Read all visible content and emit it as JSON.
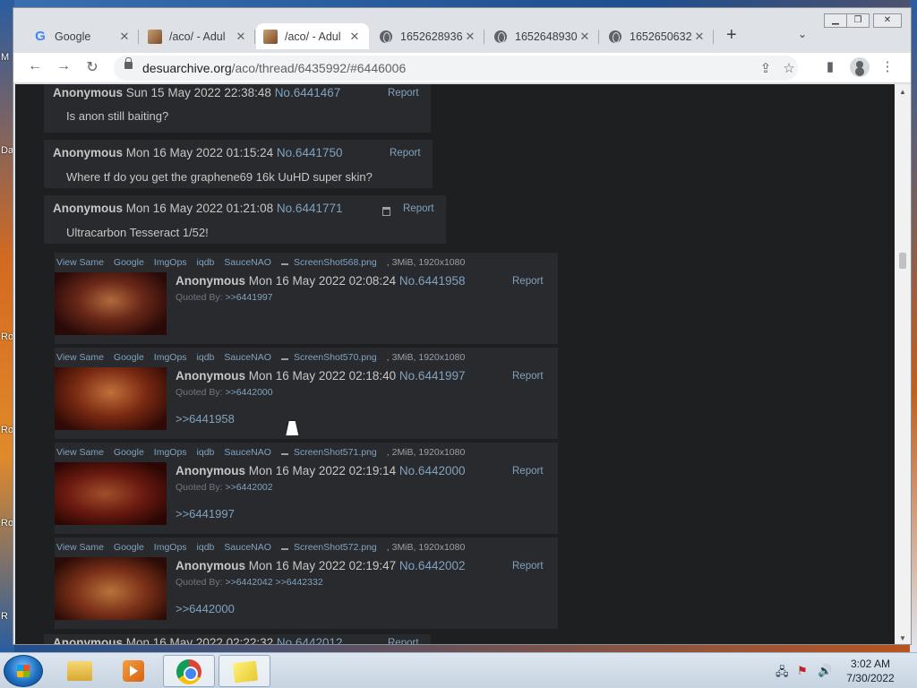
{
  "desktop": {
    "labels": [
      "M",
      "Da",
      "Ro",
      "Ro",
      "Ro",
      "R"
    ]
  },
  "browser": {
    "tabs": [
      {
        "title": "Google",
        "icon": "google-icon"
      },
      {
        "title": "/aco/ - Adul",
        "icon": "site-favicon"
      },
      {
        "title": "/aco/ - Adul",
        "icon": "site-favicon",
        "active": true
      },
      {
        "title": "1652628936",
        "icon": "globe-icon"
      },
      {
        "title": "1652648930",
        "icon": "globe-icon"
      },
      {
        "title": "1652650632",
        "icon": "globe-icon"
      }
    ],
    "tab_close": "✕",
    "new_tab": "+",
    "tab_menu": "⌄",
    "url_host": "desuarchive.org",
    "url_path": "/aco/thread/6435992/#6446006"
  },
  "posts": [
    {
      "name": "Anonymous",
      "date": "Sun 15 May 2022 22:38:48",
      "no": "No.6441467",
      "report": "Report",
      "message": "Is anon still baiting?"
    },
    {
      "name": "Anonymous",
      "date": "Mon 16 May 2022 01:15:24",
      "no": "No.6441750",
      "report": "Report",
      "message": "Where tf do you get the graphene69 16k UuHD super skin?"
    },
    {
      "name": "Anonymous",
      "date": "Mon 16 May 2022 01:21:08",
      "no": "No.6441771",
      "report": "Report",
      "message": "Ultracarbon Tesseract 1/52!"
    }
  ],
  "search_links": [
    "View Same",
    "Google",
    "ImgOps",
    "iqdb",
    "SauceNAO"
  ],
  "image_posts": [
    {
      "filename": "ScreenShot568.png",
      "meta": ", 3MiB, 1920x1080",
      "name": "Anonymous",
      "date": "Mon 16 May 2022 02:08:24",
      "no": "No.6441958",
      "report": "Report",
      "quoted_label": "Quoted By:",
      "quoted": ">>6441997",
      "reply": ""
    },
    {
      "filename": "ScreenShot570.png",
      "meta": ", 3MiB, 1920x1080",
      "name": "Anonymous",
      "date": "Mon 16 May 2022 02:18:40",
      "no": "No.6441997",
      "report": "Report",
      "quoted_label": "Quoted By:",
      "quoted": ">>6442000",
      "reply": ">>6441958"
    },
    {
      "filename": "ScreenShot571.png",
      "meta": ", 2MiB, 1920x1080",
      "name": "Anonymous",
      "date": "Mon 16 May 2022 02:19:14",
      "no": "No.6442000",
      "report": "Report",
      "quoted_label": "Quoted By:",
      "quoted": ">>6442002",
      "reply": ">>6441997"
    },
    {
      "filename": "ScreenShot572.png",
      "meta": ", 3MiB, 1920x1080",
      "name": "Anonymous",
      "date": "Mon 16 May 2022 02:19:47",
      "no": "No.6442002",
      "report": "Report",
      "quoted_label": "Quoted By:",
      "quoted": ">>6442042 >>6442332",
      "reply": ">>6442000"
    }
  ],
  "last_post": {
    "name": "Anonymous",
    "date": "Mon 16 May 2022 02:22:32",
    "no": "No.6442012",
    "report": "Report"
  },
  "taskbar": {
    "time": "3:02 AM",
    "date": "7/30/2022"
  },
  "colors": {
    "page_bg": "#1d1f21",
    "post_bg": "#282a2e",
    "link": "#81a2be",
    "text": "#c5c8c6"
  }
}
